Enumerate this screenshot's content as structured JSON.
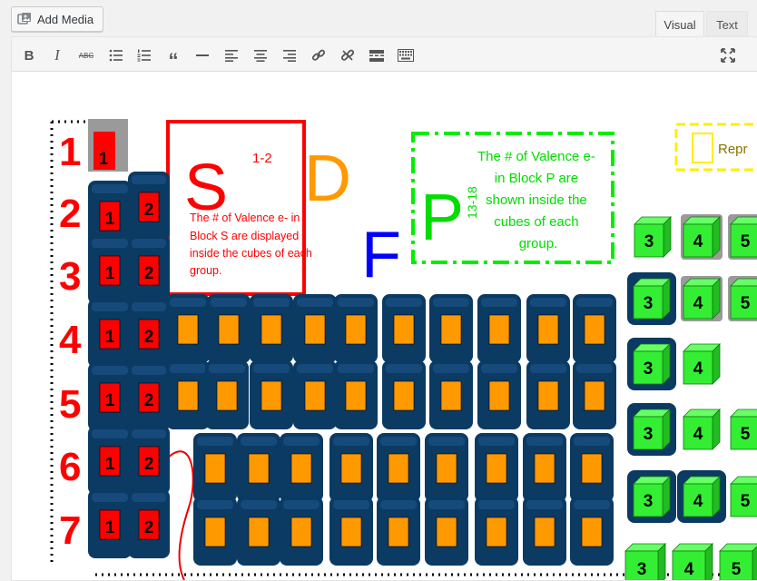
{
  "add_media": {
    "label": "Add Media",
    "icon": "media-icon"
  },
  "tabs": {
    "visual": "Visual",
    "text": "Text"
  },
  "toolbar": {
    "buttons": [
      "bold-icon",
      "italic-icon",
      "strikethrough-icon",
      "bullet-list-icon",
      "numbered-list-icon",
      "blockquote-icon",
      "horizontal-rule-icon",
      "align-left-icon",
      "align-center-icon",
      "align-right-icon",
      "link-icon",
      "unlink-icon",
      "read-more-icon",
      "toolbar-toggle-icon"
    ],
    "bold_glyph": "B",
    "italic_glyph": "I",
    "strike_glyph": "ABC",
    "fullscreen_icon": "fullscreen-icon"
  },
  "image": {
    "period_numbers": [
      "1",
      "2",
      "3",
      "4",
      "5",
      "6",
      "7"
    ],
    "s_block": {
      "letter": "S",
      "range": "1-2",
      "caption_lines": [
        "The # of Valence e- in",
        "Block S are displayed",
        "inside the cubes of each",
        "group."
      ]
    },
    "d_letter": "D",
    "f_letter": "F",
    "p_block": {
      "letter": "P",
      "range": "13-18",
      "caption_lines": [
        "The # of Valence e-",
        "in Block P are",
        "shown inside the",
        "cubes of each",
        "group."
      ]
    },
    "legend_partial": "Repr",
    "cube_labels": {
      "g1": "1",
      "g2": "2",
      "g3": "3",
      "g4": "4",
      "g5": "5"
    },
    "colors": {
      "s_red": "#ff0000",
      "d_orange": "#ff9900",
      "f_blue": "#0000ff",
      "p_green": "#00dd00",
      "cube_navy": "#0b3a63",
      "cube_orange": "#ff9900",
      "cube_green": "#33ee33",
      "cube_gray": "#9a9a9a"
    }
  }
}
